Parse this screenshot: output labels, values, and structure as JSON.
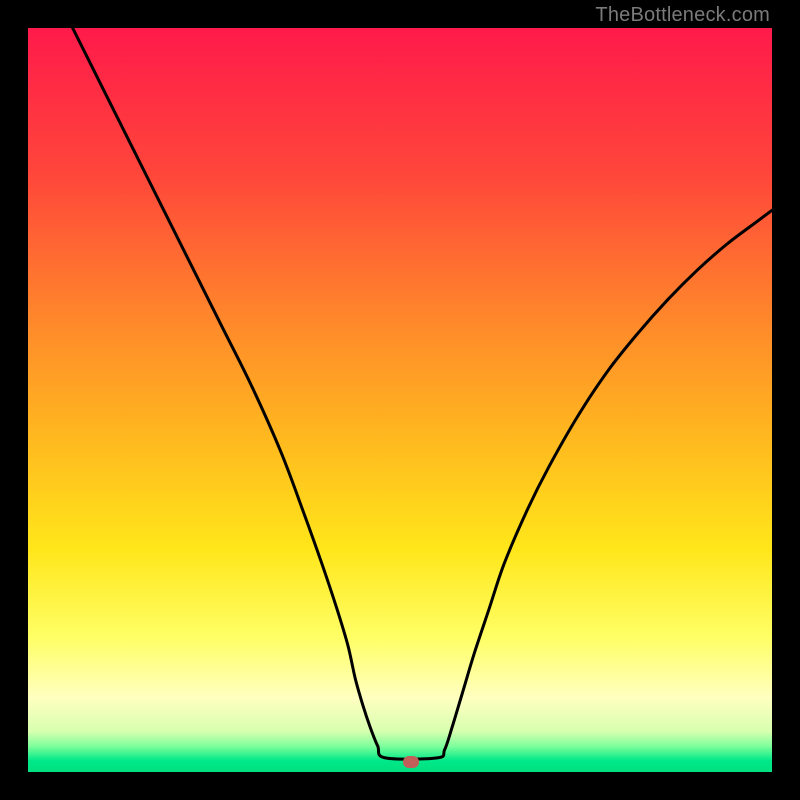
{
  "watermark": "TheBottleneck.com",
  "chart_data": {
    "type": "line",
    "title": "",
    "xlabel": "",
    "ylabel": "",
    "xlim": [
      0,
      100
    ],
    "ylim": [
      0,
      100
    ],
    "grid": false,
    "legend": false,
    "background_gradient": {
      "stops": [
        {
          "pos": 0.0,
          "color": "#ff1a4b"
        },
        {
          "pos": 0.2,
          "color": "#ff473a"
        },
        {
          "pos": 0.4,
          "color": "#ff8a2a"
        },
        {
          "pos": 0.55,
          "color": "#ffb81f"
        },
        {
          "pos": 0.7,
          "color": "#ffe61a"
        },
        {
          "pos": 0.82,
          "color": "#ffff66"
        },
        {
          "pos": 0.9,
          "color": "#ffffc0"
        },
        {
          "pos": 0.945,
          "color": "#d8ffb0"
        },
        {
          "pos": 0.965,
          "color": "#80ff9c"
        },
        {
          "pos": 0.985,
          "color": "#00e888"
        },
        {
          "pos": 1.0,
          "color": "#00e080"
        }
      ]
    },
    "series": [
      {
        "name": "bottleneck-curve",
        "stroke": "#000000",
        "x": [
          6,
          10,
          14,
          18,
          22,
          26,
          30,
          34,
          37,
          39.5,
          41.5,
          43,
          44,
          45,
          46,
          47,
          48,
          55,
          56,
          57,
          58.5,
          60,
          62,
          64,
          67,
          70,
          74,
          78,
          82,
          86,
          90,
          94,
          98,
          100
        ],
        "y": [
          100,
          92,
          84,
          76,
          68,
          60,
          52,
          43,
          35,
          28,
          22,
          17,
          12.5,
          9,
          6,
          3.5,
          1.9,
          1.9,
          3,
          6,
          11,
          16,
          22,
          28,
          35,
          41,
          48,
          54,
          59,
          63.5,
          67.5,
          71,
          74,
          75.5
        ]
      }
    ],
    "marker": {
      "x": 51.5,
      "y": 1.3,
      "color": "#c06058"
    },
    "flat_segment": {
      "x0": 48,
      "x1": 55,
      "y": 1.9
    }
  }
}
